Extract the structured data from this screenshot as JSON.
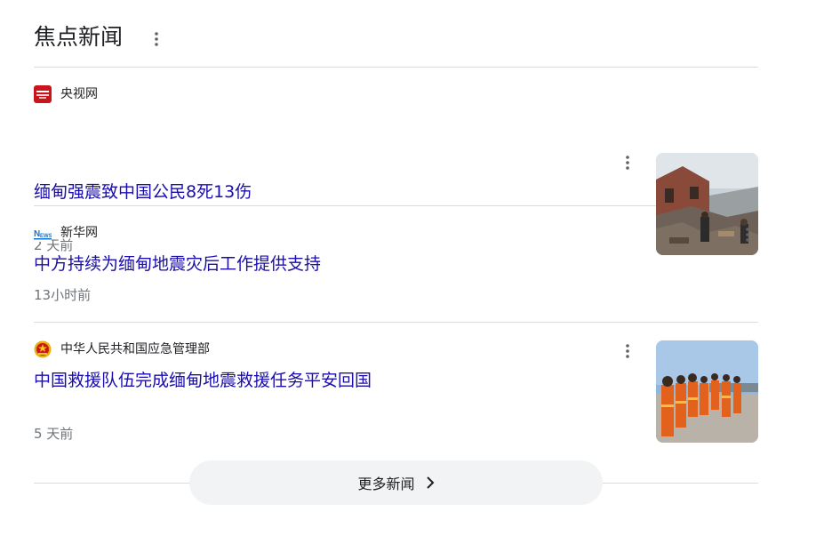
{
  "section": {
    "title": "焦点新闻"
  },
  "news": [
    {
      "source": "央视网",
      "headline": "缅甸强震致中国公民8死13伤",
      "time": "2 天前",
      "logo_icon": "cctv-logo-icon",
      "thumbnail": "earthquake-ruins-photo"
    },
    {
      "source": "新华网",
      "headline": "中方持续为缅甸地震灾后工作提供支持",
      "time": "13小时前",
      "logo_icon": "xinhua-news-logo-icon"
    },
    {
      "source": "中华人民共和国应急管理部",
      "headline": "中国救援队伍完成缅甸地震救援任务平安回国",
      "time": "5 天前",
      "logo_icon": "national-emblem-icon",
      "thumbnail": "rescue-team-photo"
    }
  ],
  "more": {
    "label": "更多新闻",
    "icon": "chevron-right-icon"
  },
  "colors": {
    "link": "#1a0dab",
    "meta": "#70757a",
    "divider": "#dadce0",
    "button_bg": "#f1f3f4"
  }
}
